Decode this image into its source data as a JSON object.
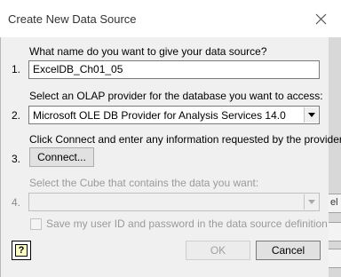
{
  "dialog": {
    "title": "Create New Data Source",
    "close_icon": "close-icon"
  },
  "steps": [
    {
      "number": "1.",
      "prompt": "What name do you want to give your data source?",
      "value": "ExcelDB_Ch01_05"
    },
    {
      "number": "2.",
      "prompt": "Select an OLAP provider for the database you want to access:",
      "selected": "Microsoft OLE DB Provider for Analysis Services 14.0"
    },
    {
      "number": "3.",
      "prompt": "Click Connect and enter any information requested by the provider:",
      "button": "Connect..."
    },
    {
      "number": "4.",
      "prompt": "Select the Cube that contains the data you want:",
      "selected": ""
    }
  ],
  "save_credentials": {
    "label": "Save my user ID and password in the data source definition",
    "checked": false
  },
  "footer": {
    "ok": "OK",
    "cancel": "Cancel",
    "help_glyph": "?"
  },
  "background_tabs": [
    "el",
    "",
    ""
  ]
}
